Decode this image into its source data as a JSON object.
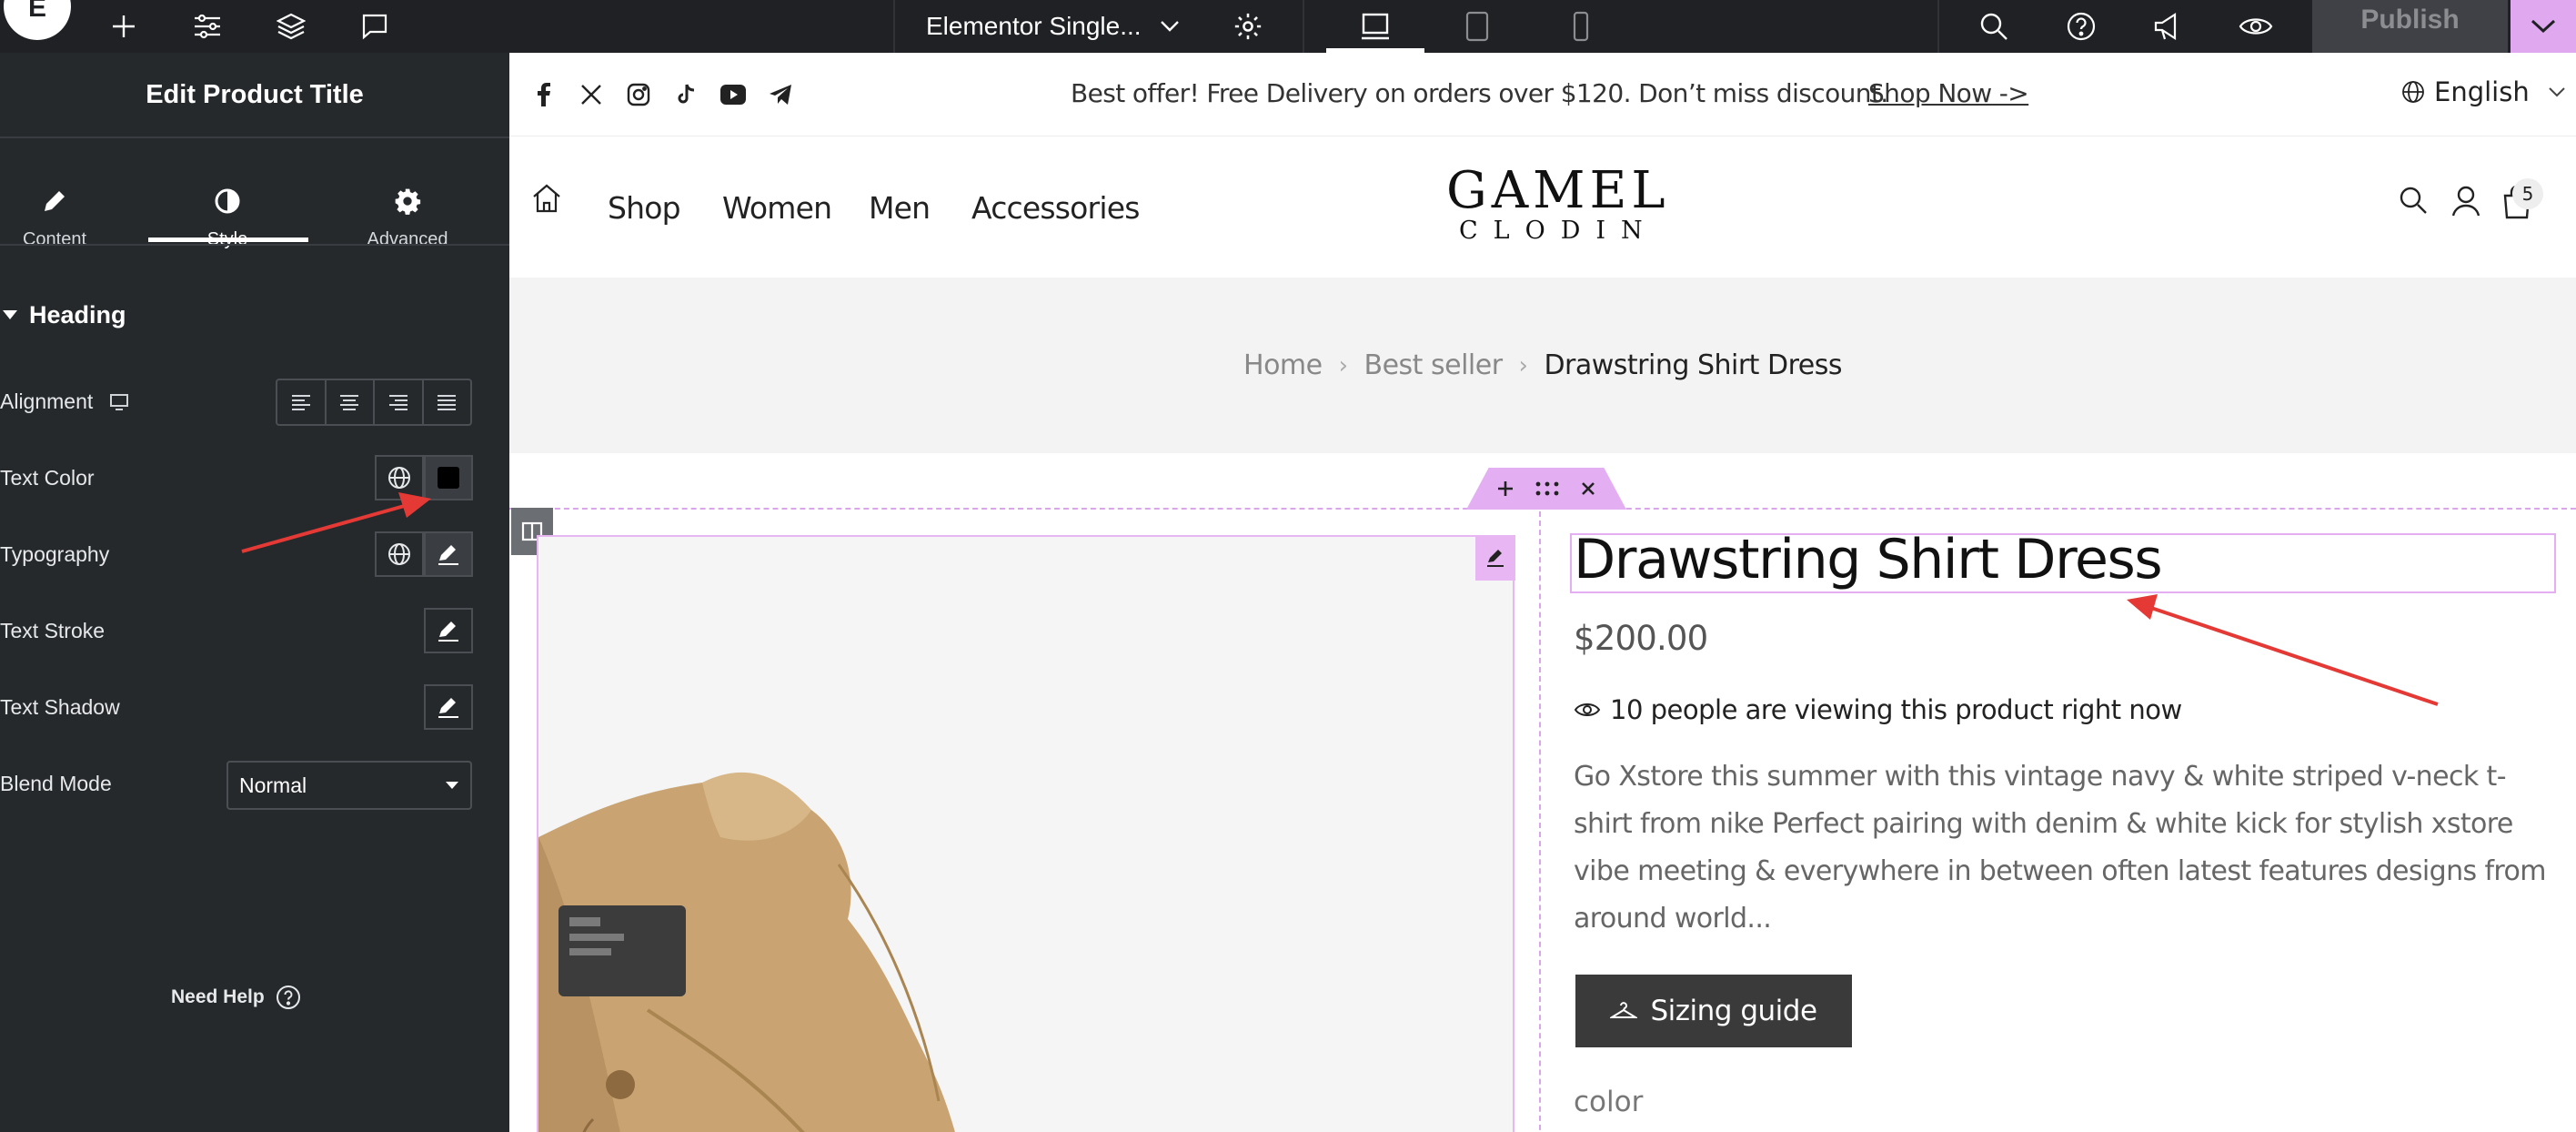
{
  "app": {
    "document_title": "Elementor Single...",
    "publish_label": "Publish"
  },
  "panel": {
    "title": "Edit Product Title",
    "tabs": [
      {
        "label": "Content",
        "icon": "pencil-icon"
      },
      {
        "label": "Style",
        "icon": "half-circle-icon",
        "active": true
      },
      {
        "label": "Advanced",
        "icon": "gear-icon"
      }
    ],
    "section": "Heading",
    "controls": {
      "alignment": "Alignment",
      "text_color": "Text Color",
      "text_color_value": "#000000",
      "typography": "Typography",
      "text_stroke": "Text Stroke",
      "text_shadow": "Text Shadow",
      "blend_mode": "Blend Mode",
      "blend_mode_value": "Normal"
    },
    "need_help": "Need Help"
  },
  "site": {
    "announcement": "Best offer! Free Delivery on orders over $120. Don’t miss discount.",
    "shop_now": "Shop Now ->",
    "language": "English",
    "nav": [
      "Shop",
      "Women",
      "Men",
      "Accessories"
    ],
    "brand_line1": "GAMEL",
    "brand_line2": "CLODIN",
    "cart_count": "5",
    "breadcrumbs": [
      "Home",
      "Best seller",
      "Drawstring Shirt Dress"
    ],
    "product": {
      "title": "Drawstring Shirt Dress",
      "price": "$200.00",
      "viewers": "10 people are viewing this product right now",
      "description": "Go Xstore this summer with this vintage navy & white striped v-neck t-shirt from nike Perfect pairing with denim & white kick for stylish xstore vibe meeting & everywhere in between often latest features designs from around world...",
      "sizing_guide": "Sizing guide",
      "color_label": "color"
    }
  },
  "colors": {
    "editor_dark": "#26292c",
    "topbar": "#1f2124",
    "accent_pink": "#e3aff2",
    "annotation_red": "#e53935"
  }
}
